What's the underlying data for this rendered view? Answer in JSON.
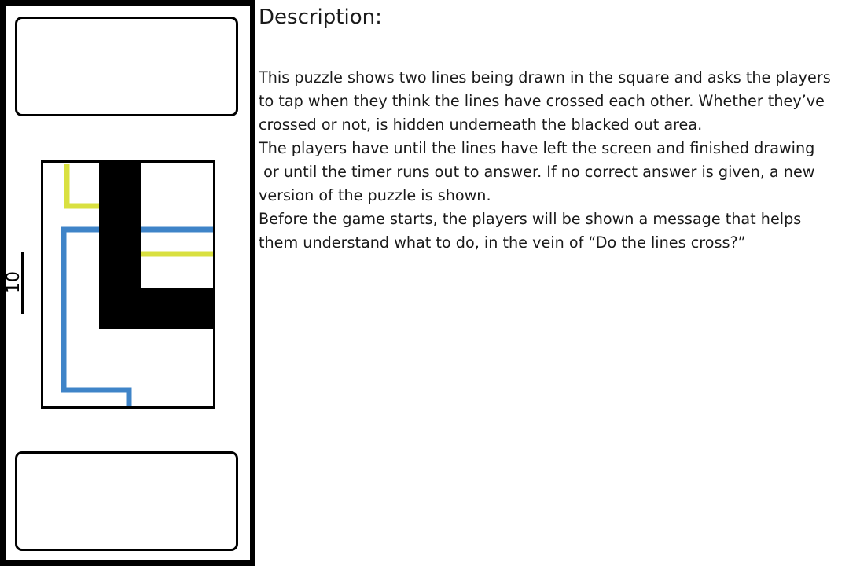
{
  "game": {
    "timer_value": "10",
    "line_colors": {
      "first_line": "#d9e040",
      "second_line": "#3f84c8",
      "blackout": "#000000"
    }
  },
  "description": {
    "title": "Description:",
    "lines": [
      "This puzzle shows two lines being drawn in the square and asks the players",
      "to tap when they think the lines have crossed each other. Whether they’ve",
      "crossed or not, is hidden underneath the blacked out area.",
      "The players have until the lines have left the screen and finished drawing",
      " or until the timer runs out to answer. If no correct answer is given, a new",
      "version of the puzzle is shown.",
      "Before the game starts, the players will be shown a message that helps",
      "them understand what to do, in the vein of “Do the lines cross?”"
    ]
  }
}
